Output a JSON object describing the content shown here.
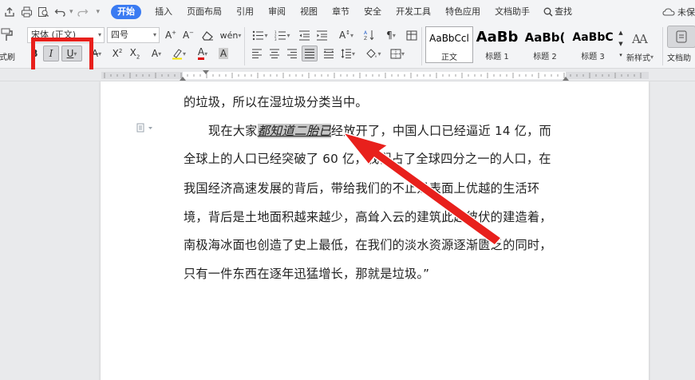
{
  "menubar": {
    "tabs": [
      "开始",
      "插入",
      "页面布局",
      "引用",
      "审阅",
      "视图",
      "章节",
      "安全",
      "开发工具",
      "特色应用",
      "文档助手"
    ],
    "search_label": "查找",
    "unsaved_label": "未保"
  },
  "ribbon": {
    "format_painter_label": "式刷",
    "font_name": "宋体 (正文)",
    "font_size": "四号",
    "style_gallery": [
      {
        "sample": "AaBbCcl",
        "name": "正文"
      },
      {
        "sample": "AaBb",
        "name": "标题 1"
      },
      {
        "sample": "AaBb(",
        "name": "标题 2"
      },
      {
        "sample": "AaBbC",
        "name": "标题 3"
      }
    ],
    "new_style_label": "新样式",
    "doc_assistant_label": "文档助",
    "annotation_color": "#e8201c"
  },
  "document": {
    "line_prev": "的垃圾，所以在湿垃圾分类当中。",
    "line1_prefix": "现在大家",
    "line1_selected": "都知道二胎已",
    "line1_suffix": "经放开了，中国人口已经逼近 14 亿，而",
    "line2": "全球上的人口已经突破了 60 亿，我们占了全球四分之一的人口，在",
    "line3": "我国经济高速发展的背后，带给我们的不止是表面上优越的生活环",
    "line4": "境，背后是土地面积越来越少，高耸入云的建筑此起彼伏的建造着，",
    "line5": "南极海冰面也创造了史上最低，在我们的淡水资源逐渐匮乏的同时，",
    "line6": "只有一件东西在逐年迅猛增长，那就是垃圾。”"
  }
}
